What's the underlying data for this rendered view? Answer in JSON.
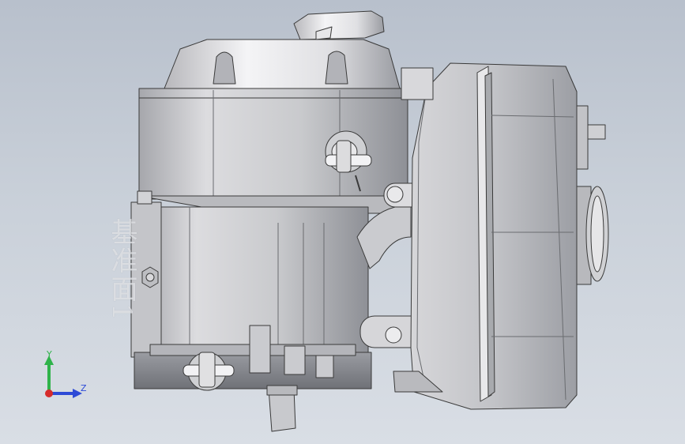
{
  "viewport": {
    "background_top": "#b8c0cc",
    "background_bottom": "#d9dee5"
  },
  "model": {
    "reference_plane_label": "基准面1",
    "body_color": "#d6d6d8",
    "shadow_color": "#8e9096",
    "edge_color": "#3a3a3a"
  },
  "triad": {
    "y_label": "Y",
    "z_label": "Z",
    "y_color": "#2fb34a",
    "z_color": "#2d4ad6",
    "x_color": "#d62b2b"
  }
}
